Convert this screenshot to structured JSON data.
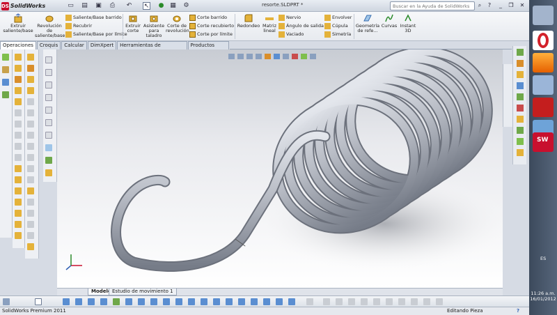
{
  "app": {
    "brand": "SolidWorks",
    "doc_title": "resorte.SLDPRT *",
    "search_placeholder": "Buscar en la Ayuda de SolidWorks"
  },
  "ribbon": {
    "extrude_boss": "Extruir saliente/base",
    "revolve_boss": "Revolución de saliente/base",
    "swept_boss": "Saliente/Base barrido",
    "wrap": "Recubrir",
    "boundary_boss": "Saliente/Base por límite",
    "extrude_cut": "Extruir corte",
    "hole_wizard": "Asistente para taladro",
    "revolve_cut": "Corte de revolución",
    "swept_cut": "Corte barrido",
    "loft_cut": "Corte recubierto",
    "boundary_cut": "Corte por límite",
    "fillet": "Redondeo",
    "linear_pattern": "Matriz lineal",
    "rib": "Nervio",
    "draft": "Ángulo de salida",
    "shell": "Vaciado",
    "wrap2": "Envolver",
    "dome": "Cúpula",
    "mirror": "Simetría",
    "ref_geometry": "Geometría de refe...",
    "curves": "Curvas",
    "instant3d": "Instant 3D"
  },
  "tabs": [
    "Operaciones",
    "Croquis",
    "Calcular",
    "DimXpert",
    "Herramientas de renderizado",
    "Productos Office"
  ],
  "bottom_tabs": [
    "Modelo",
    "Estudio de movimiento 1"
  ],
  "status": {
    "left": "SolidWorks Premium 2011",
    "right": "Editando Pieza"
  },
  "taskbar": {
    "lang": "ES",
    "time": "11:26 a.m.",
    "date": "16/01/2012"
  },
  "colors": {
    "spring": "#b9bdc6",
    "viewport_bottom": "#ffffff",
    "accent": "#c8102e"
  }
}
